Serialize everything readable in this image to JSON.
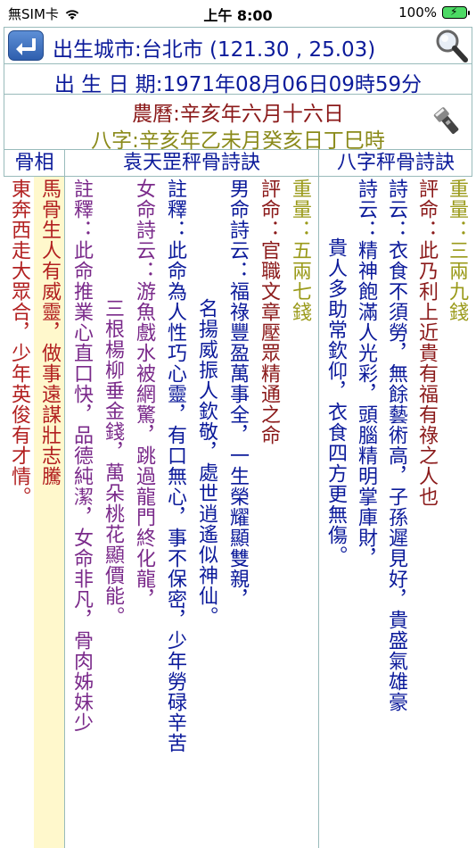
{
  "status_bar": {
    "carrier": "無SIM卡",
    "time": "上午 8:00",
    "battery": "100%"
  },
  "header": {
    "city": "出生城市:台北市 (121.30 , 25.03)",
    "birth_date": "出 生 日 期:1971年08月06日09時59分",
    "lunar": "農曆:辛亥年六月十六日",
    "bazi": "八字:辛亥年乙未月癸亥日丁巳時"
  },
  "table": {
    "headers": {
      "gu": "骨相",
      "yuan": "袁天罡秤骨詩訣",
      "bazi": "八字秤骨詩訣"
    },
    "gu_col1": "東奔西走大眾合，少年英俊有才情。",
    "gu_col2": "馬骨生人有威靈，做事遠謀壯志騰",
    "yuan_cols": [
      "註釋：此命推業心直口快，品德純潔，女命非凡，骨肉姊妹少",
      "三根楊柳垂金錢，萬朵桃花顯價能。",
      "女命詩云：游魚戲水被網驚，跳過龍門終化龍，",
      "註釋：此命為人性巧心靈，有口無心，事不保密，少年勞碌辛苦",
      "名揚威振人欽敬，處世逍遙似神仙。",
      "男命詩云：福祿豐盈萬事全，一生榮耀顯雙親，",
      "評命：官職文章壓眾精通之命",
      "重量：五兩七錢"
    ],
    "bazi_cols": [
      "貴人多助常欽仰，衣食四方更無傷。",
      "詩云：精神飽滿人光彩，頭腦精明掌庫財，",
      "詩云：衣食不須勞，無餘藝術高，子孫遲見好，貴盛氣雄豪",
      "評命：此乃利上近貴有福有祿之人也",
      "重量：三兩九錢"
    ]
  }
}
